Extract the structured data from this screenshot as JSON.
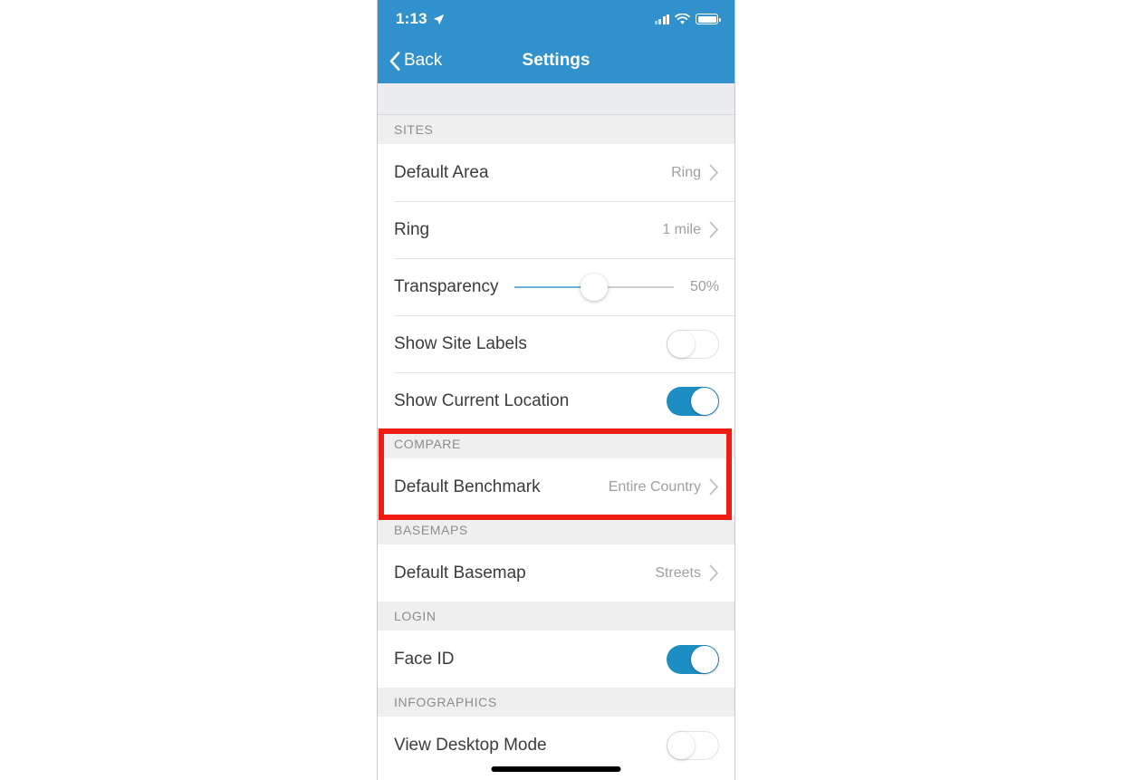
{
  "statusbar": {
    "time": "1:13",
    "location_icon": "location-arrow-icon",
    "signal_icon": "cellular-signal-icon",
    "wifi_icon": "wifi-icon",
    "battery_icon": "battery-full-icon"
  },
  "navbar": {
    "back_label": "Back",
    "back_icon": "chevron-left-icon",
    "title": "Settings"
  },
  "sections": [
    {
      "header": "SITES",
      "rows": [
        {
          "label": "Default Area",
          "value": "Ring",
          "type": "disclosure"
        },
        {
          "label": "Ring",
          "value": "1 mile",
          "type": "disclosure"
        },
        {
          "label": "Transparency",
          "value": "50%",
          "type": "slider",
          "slider_percent": 50
        },
        {
          "label": "Show Site Labels",
          "type": "toggle",
          "toggle_state": "off"
        },
        {
          "label": "Show Current Location",
          "type": "toggle",
          "toggle_state": "on"
        }
      ]
    },
    {
      "header": "COMPARE",
      "highlighted": true,
      "rows": [
        {
          "label": "Default Benchmark",
          "value": "Entire Country",
          "type": "disclosure"
        }
      ]
    },
    {
      "header": "BASEMAPS",
      "rows": [
        {
          "label": "Default Basemap",
          "value": "Streets",
          "type": "disclosure"
        }
      ]
    },
    {
      "header": "LOGIN",
      "rows": [
        {
          "label": "Face ID",
          "type": "toggle",
          "toggle_state": "on"
        }
      ]
    },
    {
      "header": "INFOGRAPHICS",
      "rows": [
        {
          "label": "View Desktop Mode",
          "type": "toggle",
          "toggle_state": "off"
        }
      ]
    }
  ],
  "colors": {
    "header_blue": "#3191cc",
    "toggle_on": "#1d8ec4",
    "slider_fill": "#6ab4d8",
    "highlight_red": "#ee1c12",
    "section_header_bg": "#efefef"
  },
  "home_indicator": "home-indicator"
}
